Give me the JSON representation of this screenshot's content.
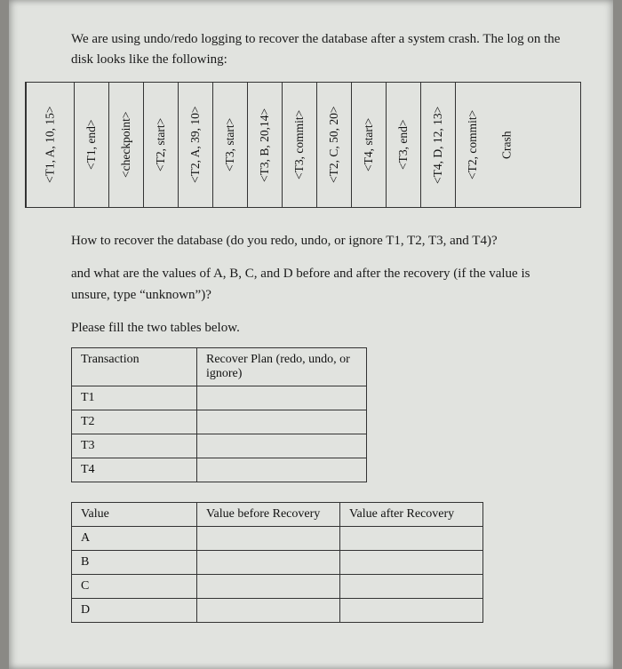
{
  "intro": "We are using undo/redo logging to recover the database after a system crash. The log on the disk looks like the following:",
  "log_entries": [
    "<T1, A, 10, 15>",
    "<T1, end>",
    "<checkpoint>",
    "<T2, start>",
    "<T2, A, 39, 10>",
    "<T3, start>",
    "<T3, B, 20,14>",
    "<T3, commit>",
    "<T2, C, 50, 20>",
    "<T4, start>",
    "<T3, end>",
    "<T4, D, 12, 13>",
    "<T2, commit>",
    "Crash"
  ],
  "question": {
    "line1": "How to recover the database (do you redo, undo, or ignore T1, T2, T3, and T4)?",
    "line2": "and what are the values of A, B, C, and D before and after the recovery (if the value is unsure, type “unknown”)?",
    "line3": "Please fill the two tables below."
  },
  "table1": {
    "headers": {
      "c1": "Transaction",
      "c2": "Recover Plan (redo, undo, or ignore)"
    },
    "rows": [
      "T1",
      "T2",
      "T3",
      "T4"
    ]
  },
  "table2": {
    "headers": {
      "c1": "Value",
      "c2": "Value before Recovery",
      "c3": "Value after Recovery"
    },
    "rows": [
      "A",
      "B",
      "C",
      "D"
    ]
  }
}
